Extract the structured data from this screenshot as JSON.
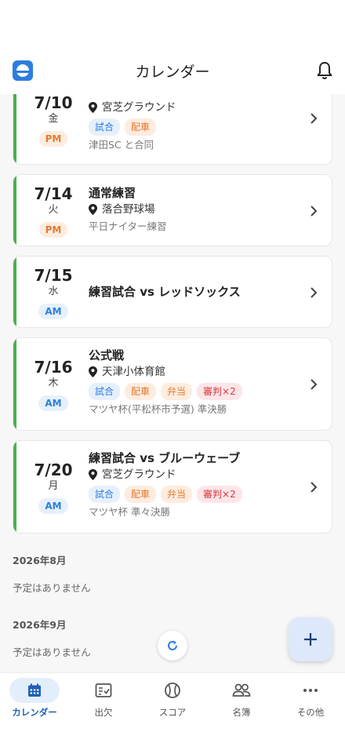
{
  "header": {
    "title": "カレンダー"
  },
  "colors": {
    "accent": "#2d7ee0",
    "stripe": "#4caf50",
    "pm": "#e57a2d",
    "am": "#2d7ee0",
    "referee": "#d9363e"
  },
  "events": [
    {
      "date": "7/10",
      "dow": "金",
      "period": "PM",
      "location": "宮芝グラウンド",
      "tags": [
        "試合",
        "配車"
      ],
      "note": "津田SC と合同"
    },
    {
      "date": "7/14",
      "dow": "火",
      "period": "PM",
      "title": "通常練習",
      "location": "落合野球場",
      "note": "平日ナイター練習"
    },
    {
      "date": "7/15",
      "dow": "水",
      "period": "AM",
      "title": "練習試合 vs レッドソックス"
    },
    {
      "date": "7/16",
      "dow": "木",
      "period": "AM",
      "title": "公式戦",
      "location": "天津小体育館",
      "tags": [
        "試合",
        "配車",
        "弁当",
        "審判×2"
      ],
      "note": "マツヤ杯(平松杯市予選) 準決勝"
    },
    {
      "date": "7/20",
      "dow": "月",
      "period": "AM",
      "title": "練習試合 vs ブルーウェーブ",
      "location": "宮芝グラウンド",
      "tags": [
        "試合",
        "配車",
        "弁当",
        "審判×2"
      ],
      "note": "マツヤ杯 準々決勝"
    }
  ],
  "months": [
    {
      "label": "2026年8月",
      "empty": "予定はありません"
    },
    {
      "label": "2026年9月",
      "empty": "予定はありません"
    }
  ],
  "tabs": [
    {
      "label": "カレンダー",
      "icon": "calendar-icon",
      "active": true
    },
    {
      "label": "出欠",
      "icon": "attendance-icon"
    },
    {
      "label": "スコア",
      "icon": "baseball-icon"
    },
    {
      "label": "名簿",
      "icon": "people-icon"
    },
    {
      "label": "その他",
      "icon": "more-icon"
    }
  ]
}
